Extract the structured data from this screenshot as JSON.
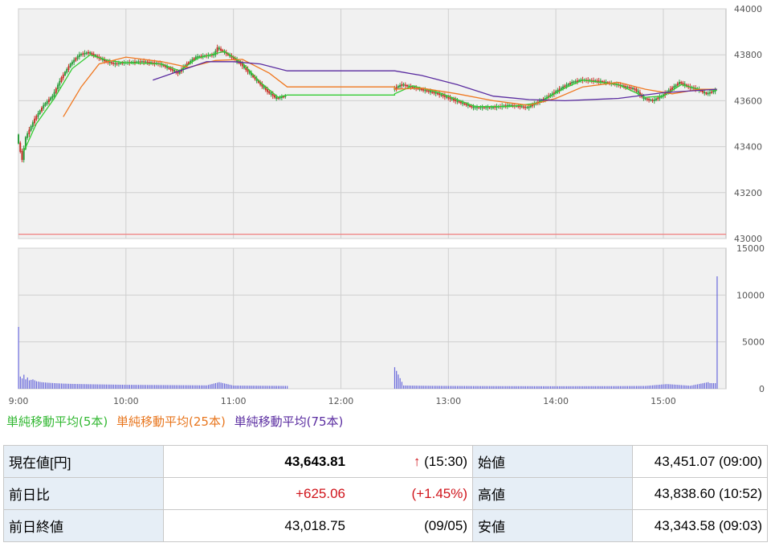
{
  "chart_data": [
    {
      "type": "candlestick",
      "x_axis_ticks": [
        "9:00",
        "10:00",
        "11:00",
        "12:00",
        "13:00",
        "14:00",
        "15:00"
      ],
      "y_axis_ticks": [
        "43000",
        "43200",
        "43400",
        "43600",
        "43800",
        "44000"
      ],
      "ylim": [
        43000,
        44000
      ],
      "grid": true,
      "reference_line": {
        "label": "前日終値",
        "value": 43018.75,
        "color": "#f08080"
      },
      "price_path": [
        {
          "t": "09:00",
          "v": 43451
        },
        {
          "t": "09:03",
          "v": 43344
        },
        {
          "t": "09:05",
          "v": 43440
        },
        {
          "t": "09:10",
          "v": 43520
        },
        {
          "t": "09:15",
          "v": 43580
        },
        {
          "t": "09:20",
          "v": 43620
        },
        {
          "t": "09:25",
          "v": 43700
        },
        {
          "t": "09:30",
          "v": 43760
        },
        {
          "t": "09:35",
          "v": 43800
        },
        {
          "t": "09:40",
          "v": 43810
        },
        {
          "t": "09:45",
          "v": 43790
        },
        {
          "t": "09:50",
          "v": 43770
        },
        {
          "t": "09:55",
          "v": 43760
        },
        {
          "t": "10:00",
          "v": 43765
        },
        {
          "t": "10:10",
          "v": 43770
        },
        {
          "t": "10:20",
          "v": 43760
        },
        {
          "t": "10:25",
          "v": 43740
        },
        {
          "t": "10:30",
          "v": 43720
        },
        {
          "t": "10:35",
          "v": 43760
        },
        {
          "t": "10:40",
          "v": 43790
        },
        {
          "t": "10:50",
          "v": 43800
        },
        {
          "t": "10:52",
          "v": 43830
        },
        {
          "t": "11:00",
          "v": 43790
        },
        {
          "t": "11:05",
          "v": 43760
        },
        {
          "t": "11:10",
          "v": 43720
        },
        {
          "t": "11:15",
          "v": 43680
        },
        {
          "t": "11:20",
          "v": 43640
        },
        {
          "t": "11:25",
          "v": 43610
        },
        {
          "t": "11:30",
          "v": 43620
        },
        {
          "t": "12:30",
          "v": 43650
        },
        {
          "t": "12:35",
          "v": 43670
        },
        {
          "t": "12:45",
          "v": 43650
        },
        {
          "t": "12:55",
          "v": 43630
        },
        {
          "t": "13:05",
          "v": 43600
        },
        {
          "t": "13:15",
          "v": 43570
        },
        {
          "t": "13:25",
          "v": 43570
        },
        {
          "t": "13:35",
          "v": 43580
        },
        {
          "t": "13:45",
          "v": 43570
        },
        {
          "t": "13:55",
          "v": 43610
        },
        {
          "t": "14:05",
          "v": 43660
        },
        {
          "t": "14:10",
          "v": 43680
        },
        {
          "t": "14:15",
          "v": 43690
        },
        {
          "t": "14:25",
          "v": 43685
        },
        {
          "t": "14:35",
          "v": 43670
        },
        {
          "t": "14:45",
          "v": 43650
        },
        {
          "t": "14:50",
          "v": 43610
        },
        {
          "t": "14:55",
          "v": 43600
        },
        {
          "t": "15:00",
          "v": 43620
        },
        {
          "t": "15:05",
          "v": 43650
        },
        {
          "t": "15:10",
          "v": 43680
        },
        {
          "t": "15:15",
          "v": 43660
        },
        {
          "t": "15:20",
          "v": 43650
        },
        {
          "t": "15:25",
          "v": 43630
        },
        {
          "t": "15:30",
          "v": 43644
        }
      ],
      "series": [
        {
          "name": "単純移動平均(5本)",
          "color": "#33cc33",
          "points": [
            {
              "t": "09:03",
              "v": 43380
            },
            {
              "t": "09:10",
              "v": 43500
            },
            {
              "t": "09:20",
              "v": 43610
            },
            {
              "t": "09:30",
              "v": 43740
            },
            {
              "t": "09:40",
              "v": 43800
            },
            {
              "t": "09:50",
              "v": 43775
            },
            {
              "t": "10:00",
              "v": 43765
            },
            {
              "t": "10:20",
              "v": 43760
            },
            {
              "t": "10:30",
              "v": 43730
            },
            {
              "t": "10:40",
              "v": 43785
            },
            {
              "t": "10:55",
              "v": 43815
            },
            {
              "t": "11:05",
              "v": 43765
            },
            {
              "t": "11:15",
              "v": 43680
            },
            {
              "t": "11:25",
              "v": 43615
            },
            {
              "t": "11:30",
              "v": 43625
            },
            {
              "t": "12:30",
              "v": 43630
            },
            {
              "t": "12:40",
              "v": 43665
            },
            {
              "t": "12:55",
              "v": 43635
            },
            {
              "t": "13:15",
              "v": 43575
            },
            {
              "t": "13:35",
              "v": 43575
            },
            {
              "t": "13:50",
              "v": 43590
            },
            {
              "t": "14:05",
              "v": 43655
            },
            {
              "t": "14:15",
              "v": 43690
            },
            {
              "t": "14:35",
              "v": 43670
            },
            {
              "t": "14:50",
              "v": 43615
            },
            {
              "t": "15:00",
              "v": 43620
            },
            {
              "t": "15:10",
              "v": 43670
            },
            {
              "t": "15:20",
              "v": 43650
            },
            {
              "t": "15:30",
              "v": 43645
            }
          ]
        },
        {
          "name": "単純移動平均(25本)",
          "color": "#f07820",
          "points": [
            {
              "t": "09:25",
              "v": 43530
            },
            {
              "t": "09:35",
              "v": 43660
            },
            {
              "t": "09:45",
              "v": 43760
            },
            {
              "t": "10:00",
              "v": 43790
            },
            {
              "t": "10:20",
              "v": 43770
            },
            {
              "t": "10:35",
              "v": 43745
            },
            {
              "t": "10:50",
              "v": 43775
            },
            {
              "t": "11:05",
              "v": 43780
            },
            {
              "t": "11:20",
              "v": 43720
            },
            {
              "t": "11:30",
              "v": 43660
            },
            {
              "t": "12:30",
              "v": 43650
            },
            {
              "t": "12:45",
              "v": 43655
            },
            {
              "t": "13:05",
              "v": 43630
            },
            {
              "t": "13:25",
              "v": 43600
            },
            {
              "t": "13:45",
              "v": 43580
            },
            {
              "t": "14:00",
              "v": 43610
            },
            {
              "t": "14:15",
              "v": 43660
            },
            {
              "t": "14:35",
              "v": 43680
            },
            {
              "t": "14:50",
              "v": 43650
            },
            {
              "t": "15:05",
              "v": 43630
            },
            {
              "t": "15:20",
              "v": 43650
            },
            {
              "t": "15:30",
              "v": 43650
            }
          ]
        },
        {
          "name": "単純移動平均(75本)",
          "color": "#5a2ca0",
          "points": [
            {
              "t": "10:15",
              "v": 43690
            },
            {
              "t": "10:30",
              "v": 43730
            },
            {
              "t": "10:45",
              "v": 43770
            },
            {
              "t": "11:00",
              "v": 43770
            },
            {
              "t": "11:15",
              "v": 43760
            },
            {
              "t": "11:30",
              "v": 43730
            },
            {
              "t": "12:30",
              "v": 43730
            },
            {
              "t": "12:45",
              "v": 43710
            },
            {
              "t": "13:05",
              "v": 43670
            },
            {
              "t": "13:25",
              "v": 43620
            },
            {
              "t": "13:45",
              "v": 43605
            },
            {
              "t": "14:05",
              "v": 43600
            },
            {
              "t": "14:35",
              "v": 43610
            },
            {
              "t": "15:00",
              "v": 43635
            },
            {
              "t": "15:30",
              "v": 43650
            }
          ]
        }
      ]
    },
    {
      "type": "bar",
      "x_axis_ticks": [
        "9:00",
        "10:00",
        "11:00",
        "12:00",
        "13:00",
        "14:00",
        "15:00"
      ],
      "y_axis_ticks": [
        "0",
        "5000",
        "10000",
        "15000"
      ],
      "ylim": [
        0,
        15000
      ],
      "grid": true,
      "color": "#6a6adc",
      "volume": [
        {
          "t": "09:00",
          "v": 6600
        },
        {
          "t": "09:01",
          "v": 1300
        },
        {
          "t": "09:02",
          "v": 1100
        },
        {
          "t": "09:03",
          "v": 1500
        },
        {
          "t": "09:04",
          "v": 1000
        },
        {
          "t": "09:05",
          "v": 1200
        },
        {
          "t": "09:06",
          "v": 900
        },
        {
          "t": "09:08",
          "v": 1000
        },
        {
          "t": "09:10",
          "v": 800
        },
        {
          "t": "09:13",
          "v": 700
        },
        {
          "t": "09:16",
          "v": 650
        },
        {
          "t": "09:20",
          "v": 600
        },
        {
          "t": "09:25",
          "v": 550
        },
        {
          "t": "09:30",
          "v": 520
        },
        {
          "t": "09:40",
          "v": 480
        },
        {
          "t": "09:50",
          "v": 450
        },
        {
          "t": "10:00",
          "v": 420
        },
        {
          "t": "10:15",
          "v": 400
        },
        {
          "t": "10:30",
          "v": 380
        },
        {
          "t": "10:45",
          "v": 360
        },
        {
          "t": "10:52",
          "v": 700
        },
        {
          "t": "11:00",
          "v": 340
        },
        {
          "t": "11:15",
          "v": 320
        },
        {
          "t": "11:30",
          "v": 300
        },
        {
          "t": "12:30",
          "v": 2300
        },
        {
          "t": "12:35",
          "v": 350
        },
        {
          "t": "12:45",
          "v": 320
        },
        {
          "t": "13:00",
          "v": 300
        },
        {
          "t": "13:30",
          "v": 280
        },
        {
          "t": "14:00",
          "v": 270
        },
        {
          "t": "14:30",
          "v": 280
        },
        {
          "t": "14:50",
          "v": 300
        },
        {
          "t": "15:02",
          "v": 500
        },
        {
          "t": "15:15",
          "v": 320
        },
        {
          "t": "15:25",
          "v": 700
        },
        {
          "t": "15:30",
          "v": 12000
        }
      ]
    }
  ],
  "legend": {
    "ma5": "単純移動平均(5本)",
    "ma25": "単純移動平均(25本)",
    "ma75": "単純移動平均(75本)"
  },
  "quote": {
    "current_label": "現在値[円]",
    "current_value": "43,643.81",
    "current_arrow": "↑",
    "current_time": "(15:30)",
    "open_label": "始値",
    "open_value": "43,451.07 (09:00)",
    "change_label": "前日比",
    "change_value": "+625.06",
    "change_pct": "(+1.45%)",
    "high_label": "高値",
    "high_value": "43,838.60 (10:52)",
    "prev_close_label": "前日終値",
    "prev_close_value": "43,018.75",
    "prev_close_date": "(09/05)",
    "low_label": "安値",
    "low_value": "43,343.58 (09:03)"
  }
}
